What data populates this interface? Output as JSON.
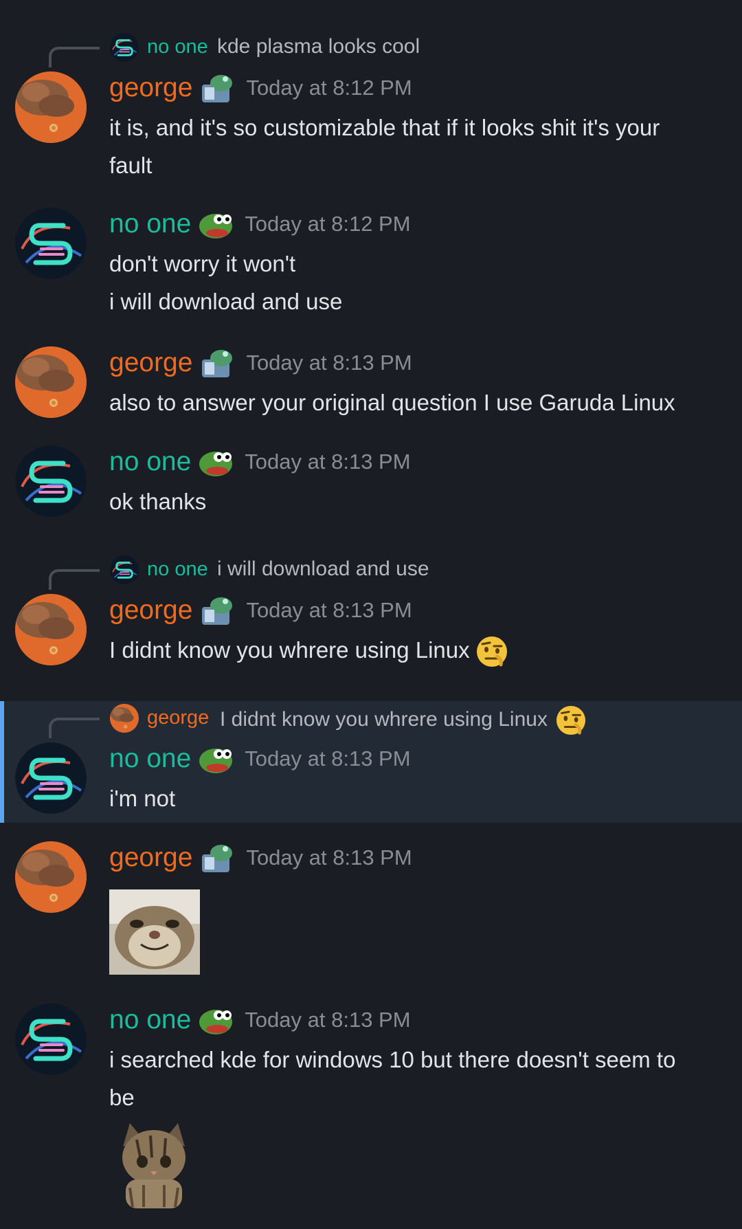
{
  "colors": {
    "background": "#1a1d24",
    "highlight_bg": "#222a36",
    "highlight_bar": "#5aa5f0",
    "george": "#f26b1d",
    "no_one": "#1abc9c",
    "timestamp": "#8a8d94",
    "text": "#e3e4e8"
  },
  "replies": [
    {
      "author": "no one",
      "text": "kde plasma looks cool"
    },
    {
      "author": "no one",
      "text": "i will download and use"
    },
    {
      "author": "george",
      "text": "I didnt know you whrere using Linux",
      "emoji": "face-with-raised-eyebrow-icon"
    }
  ],
  "messages": [
    {
      "author": "george",
      "badge": "armored-frog-icon",
      "time": "Today at 8:12 PM",
      "lines": [
        "it is, and it's so customizable that if it looks shit it's your",
        "fault"
      ]
    },
    {
      "author": "no one",
      "badge": "pepe-frog-icon",
      "time": "Today at 8:12 PM",
      "lines": [
        "don't worry it won't",
        "i will download and use"
      ]
    },
    {
      "author": "george",
      "badge": "armored-frog-icon",
      "time": "Today at 8:13 PM",
      "lines": [
        "also to answer your original question I use Garuda Linux"
      ]
    },
    {
      "author": "no one",
      "badge": "pepe-frog-icon",
      "time": "Today at 8:13 PM",
      "lines": [
        "ok thanks"
      ]
    },
    {
      "author": "george",
      "badge": "armored-frog-icon",
      "time": "Today at 8:13 PM",
      "lines": [
        "I didnt know you whrere using Linux"
      ],
      "emoji": "face-with-raised-eyebrow-icon"
    },
    {
      "author": "no one",
      "badge": "pepe-frog-icon",
      "time": "Today at 8:13 PM",
      "lines": [
        "i'm not"
      ],
      "highlighted": true
    },
    {
      "author": "george",
      "badge": "armored-frog-icon",
      "time": "Today at 8:13 PM",
      "attachment": "smiling-cat-image"
    },
    {
      "author": "no one",
      "badge": "pepe-frog-icon",
      "time": "Today at 8:13 PM",
      "lines": [
        "i searched kde for windows 10 but there doesn't seem to",
        "be"
      ],
      "attachment": "sad-kitten-image"
    }
  ]
}
